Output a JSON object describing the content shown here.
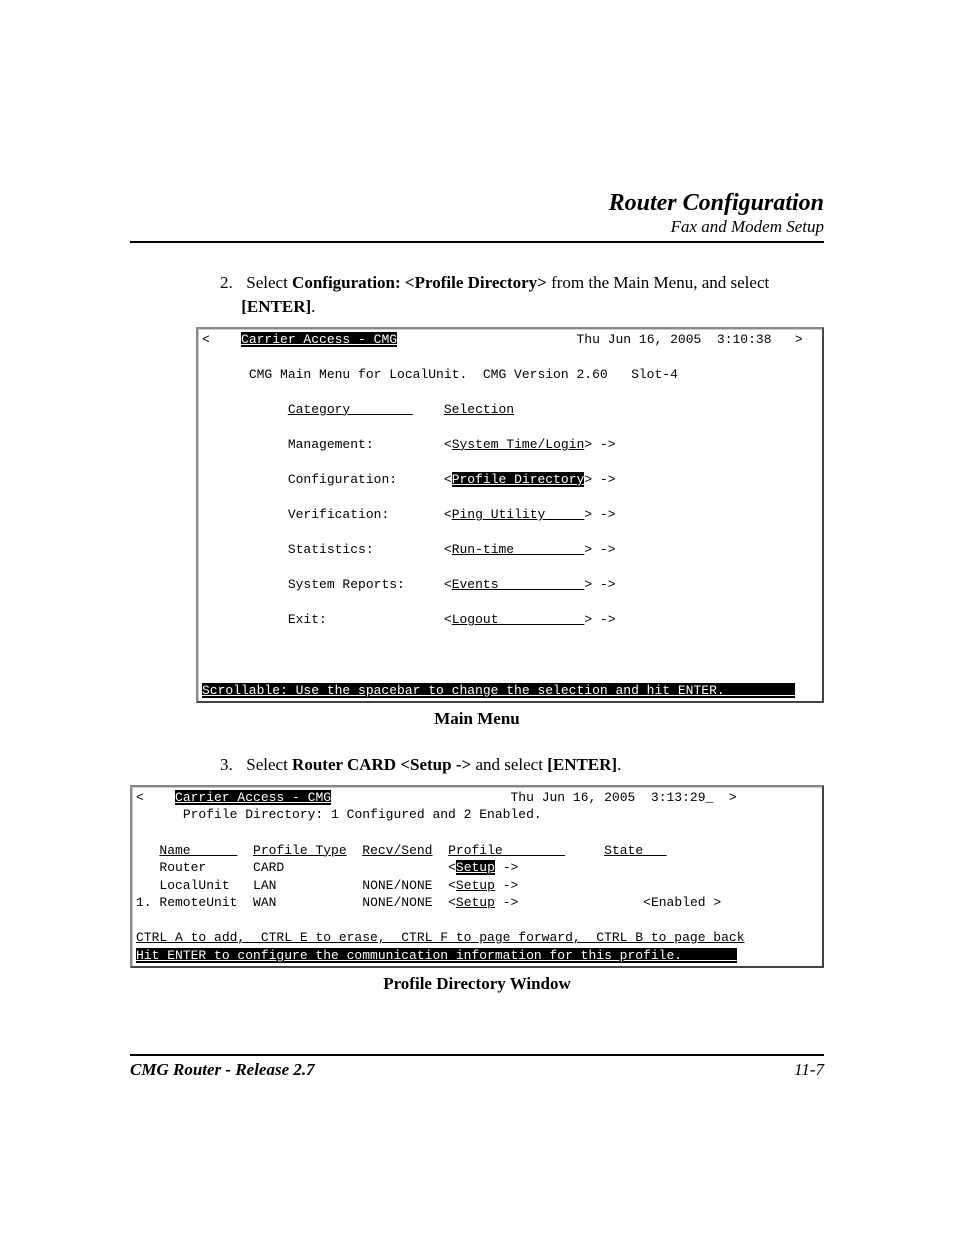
{
  "header": {
    "title": "Router Configuration",
    "subtitle": "Fax and Modem Setup"
  },
  "step2": {
    "number": "2.",
    "prefix": "Select ",
    "bold1": "Configuration: <Profile Directory>",
    "mid": " from the Main Menu, and select ",
    "enter_open": "[E",
    "enter_caps": "NTER",
    "enter_close": "]",
    "period": "."
  },
  "term1": {
    "title_inv": "Carrier Access - CMG",
    "datetime": "Thu Jun 16, 2005  3:10:38",
    "subtitle": "CMG Main Menu for LocalUnit.  CMG Version 2.60   Slot-4",
    "col_category": "Category        ",
    "col_selection": "Selection",
    "rows": [
      {
        "cat": "Management:     ",
        "sel_open": "<",
        "sel": "System Time/Login",
        "sel_close": "> ->"
      },
      {
        "cat": "Configuration:  ",
        "sel_open": "<",
        "sel_inv": "Profile Directory",
        "sel_close": "> ->"
      },
      {
        "cat": "Verification:   ",
        "sel_open": "<",
        "sel": "Ping Utility     ",
        "sel_close": "> ->"
      },
      {
        "cat": "Statistics:     ",
        "sel_open": "<",
        "sel": "Run-time         ",
        "sel_close": "> ->"
      },
      {
        "cat": "System Reports: ",
        "sel_open": "<",
        "sel": "Events           ",
        "sel_close": "> ->"
      },
      {
        "cat": "Exit:           ",
        "sel_open": "<",
        "sel": "Logout           ",
        "sel_close": "> ->"
      }
    ],
    "footer_bar": "Scrollable: Use the spacebar to change the selection and hit ENTER.         "
  },
  "caption1": "Main Menu",
  "step3": {
    "number": "3.",
    "prefix": "Select ",
    "bold1": "Router CARD <Setup ->",
    "mid": " and select ",
    "enter_open": "[E",
    "enter_caps": "NTER",
    "enter_close": "]",
    "period": "."
  },
  "term2": {
    "title_inv": "Carrier Access - CMG",
    "datetime": "Thu Jun 16, 2005  3:13:29_",
    "subtitle": "Profile Directory: 1 Configured and 2 Enabled.",
    "hdr_name": "Name      ",
    "hdr_ptype": "Profile Type",
    "hdr_recv": "Recv/Send",
    "hdr_profile": "Profile        ",
    "hdr_state": "State   ",
    "rows": [
      {
        "i": "   ",
        "name": "Router    ",
        "ptype": "CARD        ",
        "recv": "         ",
        "p_open": "<",
        "p_inv": "Setup",
        "p_close": " ->",
        "state": "          "
      },
      {
        "i": "   ",
        "name": "LocalUnit ",
        "ptype": "LAN         ",
        "recv": "NONE/NONE",
        "p_open": "<",
        "p": "Setup",
        "p_close": " ->",
        "state": "          "
      },
      {
        "i": "1. ",
        "name": "RemoteUnit",
        "ptype": "WAN         ",
        "recv": "NONE/NONE",
        "p_open": "<",
        "p": "Setup",
        "p_close": " ->",
        "state": "<Enabled >"
      }
    ],
    "footer1": "CTRL A to add,  CTRL E to erase,  CTRL F to page forward,  CTRL B to page back",
    "footer2": "Hit ENTER to configure the communication information for this profile.       "
  },
  "caption2": "Profile Directory Window",
  "footer": {
    "left": "CMG Router - Release 2.7",
    "right": "11-7"
  }
}
